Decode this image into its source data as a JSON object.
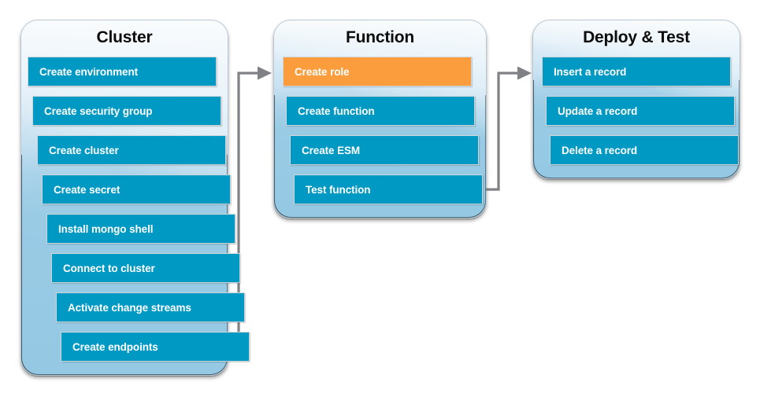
{
  "diagram": {
    "title_hidden": "",
    "colors": {
      "step_blue": "#0099c4",
      "step_highlight_orange": "#fb9d3c",
      "panel_top": "#f4f8fb",
      "panel_bottom": "#94c8e3",
      "connector_gray": "#7f8184",
      "text_light": "#ffffff",
      "title_dark": "#0c0c0c"
    },
    "panels": [
      {
        "id": "cluster",
        "title": "Cluster",
        "steps": [
          {
            "label": "Create environment",
            "highlighted": false
          },
          {
            "label": "Create security group",
            "highlighted": false
          },
          {
            "label": "Create cluster",
            "highlighted": false
          },
          {
            "label": "Create secret",
            "highlighted": false
          },
          {
            "label": "Install mongo shell",
            "highlighted": false
          },
          {
            "label": "Connect to cluster",
            "highlighted": false
          },
          {
            "label": "Activate change streams",
            "highlighted": false
          },
          {
            "label": "Create endpoints",
            "highlighted": false
          }
        ]
      },
      {
        "id": "function",
        "title": "Function",
        "steps": [
          {
            "label": "Create role",
            "highlighted": true
          },
          {
            "label": "Create function",
            "highlighted": false
          },
          {
            "label": "Create ESM",
            "highlighted": false
          },
          {
            "label": "Test function",
            "highlighted": false
          }
        ]
      },
      {
        "id": "deploy-and-test",
        "title": "Deploy & Test",
        "steps": [
          {
            "label": "Insert a record",
            "highlighted": false
          },
          {
            "label": "Update a record",
            "highlighted": false
          },
          {
            "label": "Delete a record",
            "highlighted": false
          }
        ]
      }
    ],
    "connectors": [
      {
        "id": "cluster-to-function",
        "from": "cluster",
        "to": "function",
        "shape": "elbow-up-right",
        "arrow": "right"
      },
      {
        "id": "function-to-deploy",
        "from": "function",
        "to": "deploy-and-test",
        "shape": "elbow-up-right",
        "arrow": "right"
      }
    ]
  }
}
